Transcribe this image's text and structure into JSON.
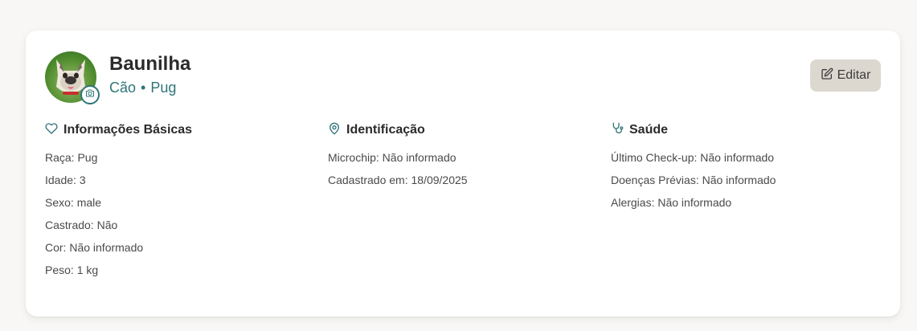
{
  "pet": {
    "name": "Baunilha",
    "species": "Cão",
    "separator": "•",
    "breed": "Pug"
  },
  "actions": {
    "edit_label": "Editar"
  },
  "sections": {
    "basic": {
      "title": "Informações Básicas",
      "icon": "heart-icon",
      "lines": [
        "Raça: Pug",
        "Idade: 3",
        "Sexo: male",
        "Castrado: Não",
        "Cor: Não informado",
        "Peso: 1 kg"
      ]
    },
    "identification": {
      "title": "Identificação",
      "icon": "map-pin-icon",
      "lines": [
        "Microchip: Não informado",
        "Cadastrado em: 18/09/2025"
      ]
    },
    "health": {
      "title": "Saúde",
      "icon": "stethoscope-icon",
      "lines": [
        "Último Check-up: Não informado",
        "Doenças Prévias: Não informado",
        "Alergias: Não informado"
      ]
    }
  },
  "colors": {
    "accent": "#2f7579",
    "edit_button_bg": "#ddd8cf",
    "page_bg": "#f8f7f5"
  }
}
